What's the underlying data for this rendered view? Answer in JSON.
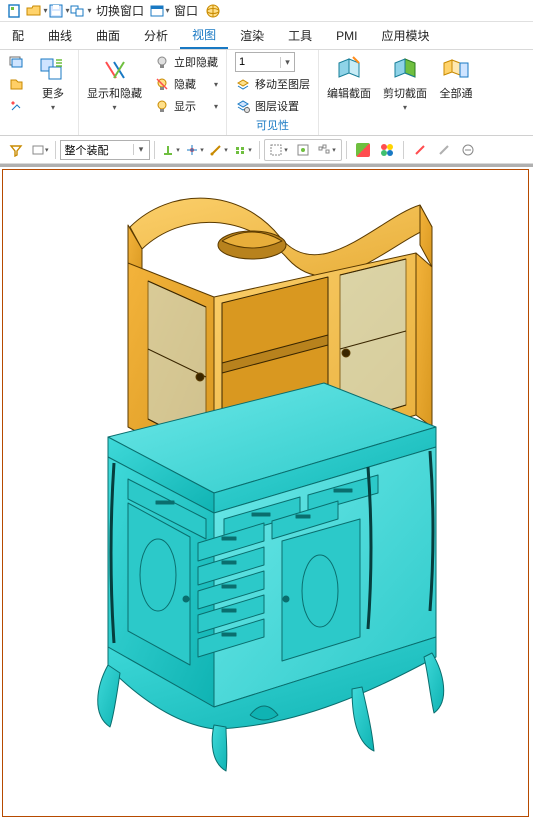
{
  "qat": {
    "switch_window": "切换窗口",
    "window": "窗口"
  },
  "menu": {
    "items": [
      {
        "label": "配"
      },
      {
        "label": "曲线"
      },
      {
        "label": "曲面"
      },
      {
        "label": "分析"
      },
      {
        "label": "视图",
        "active": true
      },
      {
        "label": "渲染"
      },
      {
        "label": "工具"
      },
      {
        "label": "PMI"
      },
      {
        "label": "应用模块"
      }
    ]
  },
  "ribbon": {
    "more": "更多",
    "show_hide": "显示和隐藏",
    "hide_now": "立即隐藏",
    "hide": "隐藏",
    "show": "显示",
    "layer_num": "1",
    "move_layer": "移动至图层",
    "layer_set": "图层设置",
    "visibility": "可见性",
    "edit_section": "编辑截面",
    "clip_section": "剪切截面",
    "all": "全部通"
  },
  "toolbar2": {
    "assembly": "整个装配"
  }
}
